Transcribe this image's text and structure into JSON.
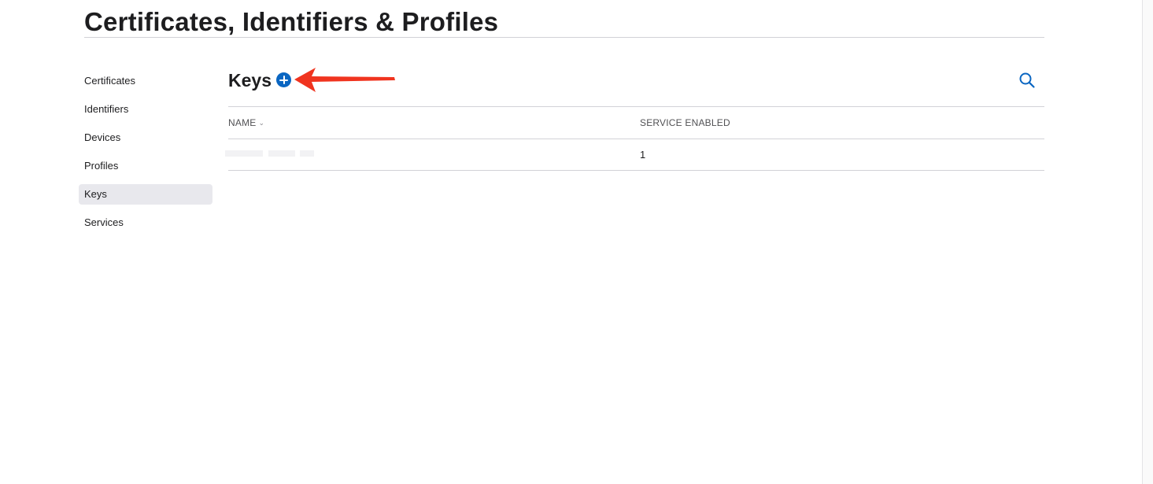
{
  "page": {
    "title": "Certificates, Identifiers & Profiles"
  },
  "sidebar": {
    "items": [
      {
        "label": "Certificates"
      },
      {
        "label": "Identifiers"
      },
      {
        "label": "Devices"
      },
      {
        "label": "Profiles"
      },
      {
        "label": "Keys",
        "active": true
      },
      {
        "label": "Services"
      }
    ]
  },
  "main": {
    "section_title": "Keys",
    "add_icon": "plus-circle-icon",
    "search_icon": "search-icon",
    "accent_color": "#0a66c2",
    "annotation_color": "#f0341f",
    "table": {
      "columns": [
        "NAME",
        "SERVICE ENABLED"
      ],
      "sort_icon": "chevron-down-icon",
      "rows": [
        {
          "name": "",
          "service_enabled": "1"
        }
      ]
    }
  }
}
